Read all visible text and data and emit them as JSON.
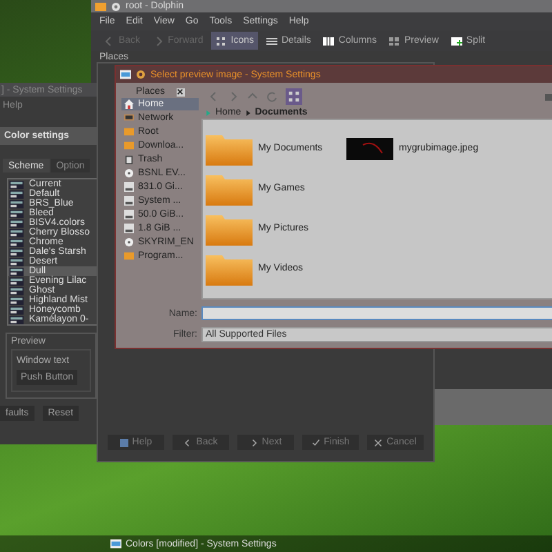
{
  "dolphin": {
    "title": "root - Dolphin",
    "menu": [
      "File",
      "Edit",
      "View",
      "Go",
      "Tools",
      "Settings",
      "Help"
    ],
    "toolbar": [
      {
        "label": "Back",
        "kind": "back",
        "disabled": true,
        "selected": false
      },
      {
        "label": "Forward",
        "kind": "forward",
        "disabled": true,
        "selected": false
      },
      {
        "label": "Icons",
        "kind": "icons",
        "disabled": false,
        "selected": true
      },
      {
        "label": "Details",
        "kind": "details",
        "disabled": false,
        "selected": false
      },
      {
        "label": "Columns",
        "kind": "columns",
        "disabled": false,
        "selected": false
      },
      {
        "label": "Preview",
        "kind": "preview",
        "disabled": false,
        "selected": false
      },
      {
        "label": "Split",
        "kind": "split",
        "disabled": false,
        "selected": false
      }
    ],
    "places_label": "Places"
  },
  "settings": {
    "title": "] - System Settings",
    "menu": [
      "Help"
    ],
    "heading": "Color settings",
    "tabs": [
      {
        "label": "Scheme",
        "selected": true
      },
      {
        "label": "Option",
        "selected": false
      }
    ],
    "schemes": [
      {
        "name": "Current",
        "selected": false
      },
      {
        "name": "Default",
        "selected": false
      },
      {
        "name": "BRS_Blue",
        "selected": false
      },
      {
        "name": "Bleed",
        "selected": false
      },
      {
        "name": "BISV4.colors",
        "selected": false
      },
      {
        "name": "Cherry Blosso",
        "selected": false
      },
      {
        "name": "Chrome",
        "selected": false
      },
      {
        "name": "Dale's Starsh",
        "selected": false
      },
      {
        "name": "Desert",
        "selected": false
      },
      {
        "name": "Dull",
        "selected": true
      },
      {
        "name": "Evening Lilac",
        "selected": false
      },
      {
        "name": "Ghost",
        "selected": false
      },
      {
        "name": "Highland Mist",
        "selected": false
      },
      {
        "name": "Honeycomb",
        "selected": false
      },
      {
        "name": "Kamélayon 0-",
        "selected": false
      }
    ],
    "preview": {
      "title": "Preview",
      "window_text": "Window text",
      "button": "Push Button"
    },
    "buttons": [
      "faults",
      "Reset"
    ]
  },
  "wizard": {
    "buttons": [
      {
        "label": "Help",
        "kind": "help"
      },
      {
        "label": "Back",
        "kind": "back"
      },
      {
        "label": "Next",
        "kind": "next"
      },
      {
        "label": "Finish",
        "kind": "finish"
      },
      {
        "label": "Cancel",
        "kind": "cancel"
      }
    ]
  },
  "file_dialog": {
    "title": "Select preview image - System Settings",
    "places_title": "Places",
    "places": [
      {
        "label": "Home",
        "kind": "home",
        "selected": true
      },
      {
        "label": "Network",
        "kind": "network",
        "selected": false
      },
      {
        "label": "Root",
        "kind": "folder",
        "selected": false
      },
      {
        "label": "Downloa...",
        "kind": "folder",
        "selected": false
      },
      {
        "label": "Trash",
        "kind": "trash",
        "selected": false
      },
      {
        "label": "BSNL EV...",
        "kind": "disc",
        "selected": false
      },
      {
        "label": "831.0 Gi...",
        "kind": "drive",
        "selected": false
      },
      {
        "label": "System ...",
        "kind": "drive",
        "selected": false
      },
      {
        "label": "50.0 GiB...",
        "kind": "drive",
        "selected": false
      },
      {
        "label": "1.8 GiB ...",
        "kind": "drive",
        "selected": false
      },
      {
        "label": "SKYRIM_EN",
        "kind": "disc",
        "selected": false
      },
      {
        "label": "Program...",
        "kind": "folder",
        "selected": false
      }
    ],
    "breadcrumb": [
      "Home",
      "Documents"
    ],
    "files": [
      {
        "name": "My Documents",
        "kind": "folder"
      },
      {
        "name": "My Games",
        "kind": "folder"
      },
      {
        "name": "My Pictures",
        "kind": "folder"
      },
      {
        "name": "My Videos",
        "kind": "folder"
      },
      {
        "name": "mygrubimage.jpeg",
        "kind": "image"
      }
    ],
    "name_label": "Name:",
    "filter_label": "Filter:",
    "filter_value": "All Supported Files"
  },
  "taskbar": {
    "task": "Colors [modified] - System Settings"
  }
}
